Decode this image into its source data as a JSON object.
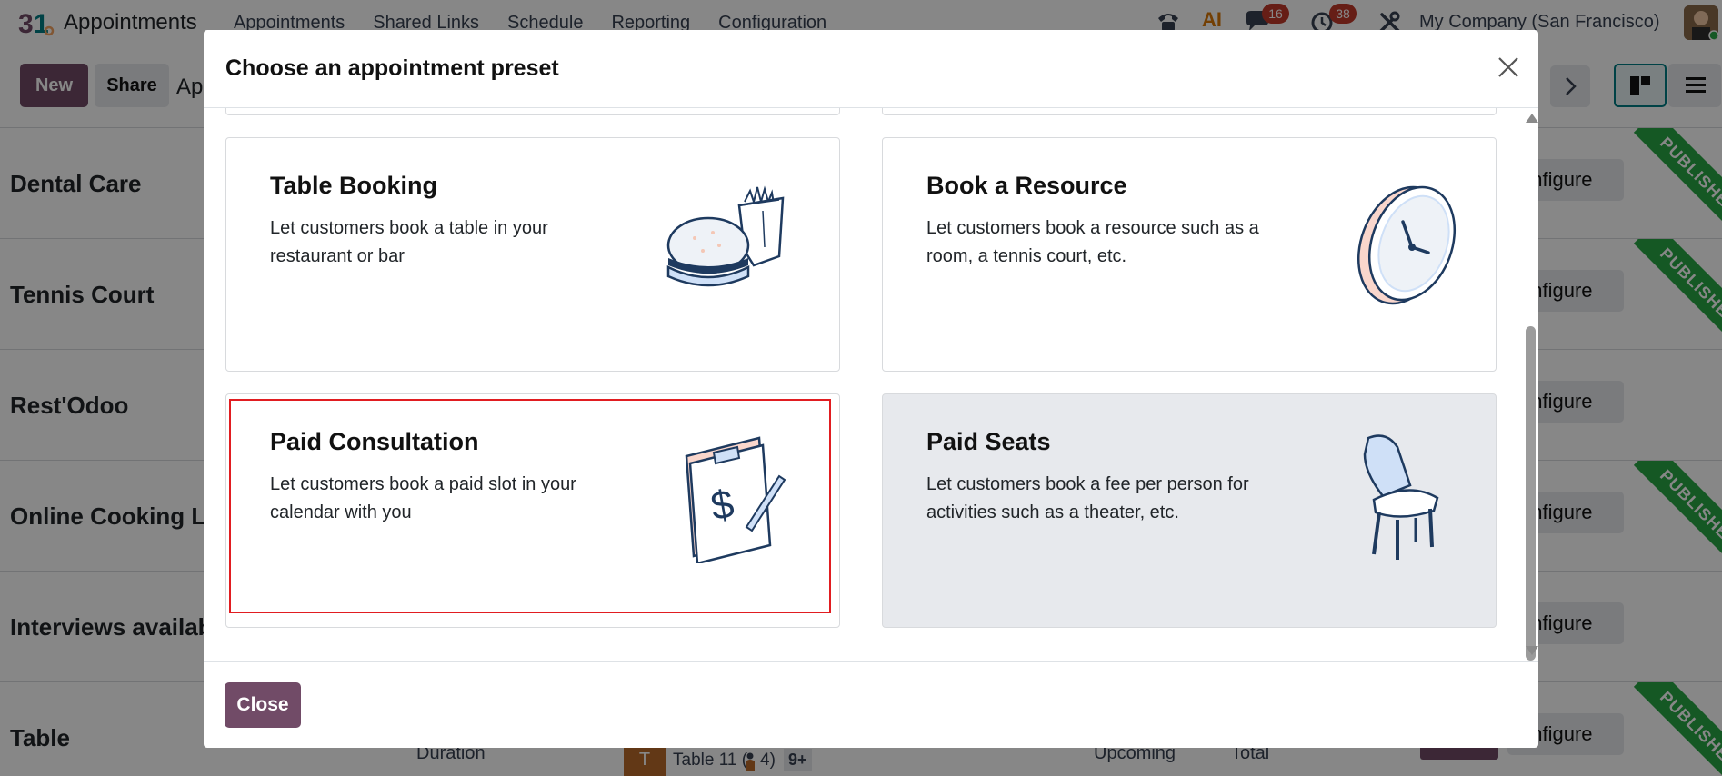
{
  "navbar": {
    "app_name": "Appointments",
    "menu": [
      "Appointments",
      "Shared Links",
      "Schedule",
      "Reporting",
      "Configuration"
    ],
    "ai_label": "AI",
    "messages_count": "16",
    "activities_count": "38",
    "company": "My Company (San Francisco)"
  },
  "control": {
    "new_label": "New",
    "share_label": "Share",
    "breadcrumb": "Ap"
  },
  "background_rows": [
    {
      "title": "Dental Care",
      "configure": "onfigure",
      "published": true
    },
    {
      "title": "Tennis Court",
      "configure": "onfigure",
      "published": true
    },
    {
      "title": "Rest'Odoo",
      "configure": "onfigure",
      "published": false
    },
    {
      "title": "Online Cooking Les",
      "configure": "onfigure",
      "published": true
    },
    {
      "title": "Interviews availabi",
      "configure": "onfigure",
      "published": false
    },
    {
      "title": "Table",
      "configure": "onfigure",
      "published": true
    }
  ],
  "ribbon_label": "PUBLISHED",
  "bottom": {
    "duration": "Duration",
    "resource_badge": "T",
    "resource": "Table 11 (",
    "resource_cap": "4)",
    "more": "9+",
    "upcoming": "Upcoming",
    "total": "Total"
  },
  "modal": {
    "title": "Choose an appointment preset",
    "close_label": "Close",
    "presets": [
      {
        "title": "Table Booking",
        "description": "Let customers book a table in your restaurant or bar",
        "icon": "burger-fries-icon"
      },
      {
        "title": "Book a Resource",
        "description": "Let customers book a resource such as a room, a tennis court, etc.",
        "icon": "clock-icon"
      },
      {
        "title": "Paid Consultation",
        "description": "Let customers book a paid slot in your calendar with you",
        "icon": "clipboard-dollar-icon"
      },
      {
        "title": "Paid Seats",
        "description": "Let customers book a fee per person for activities such as a theater, etc.",
        "icon": "chair-icon"
      }
    ]
  },
  "colors": {
    "primary": "#714b67",
    "published": "#28a745",
    "highlight": "#e11d21",
    "badge": "#c0392b"
  }
}
